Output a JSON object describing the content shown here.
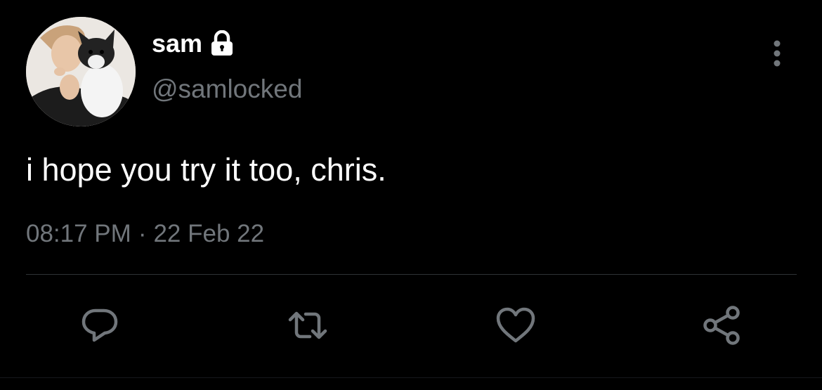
{
  "tweet": {
    "display_name": "sam",
    "handle": "@samlocked",
    "text": "i hope you try it too, chris.",
    "time": "08:17 PM",
    "separator": "·",
    "date": "22 Feb 22"
  },
  "icons": {
    "lock": "lock-icon",
    "more": "more-vertical-icon",
    "reply": "reply-icon",
    "retweet": "retweet-icon",
    "like": "heart-icon",
    "share": "share-icon"
  },
  "colors": {
    "background": "#000000",
    "text": "#ffffff",
    "secondary_text": "#71767b",
    "divider": "#2f3336",
    "icon": "#71767b"
  }
}
